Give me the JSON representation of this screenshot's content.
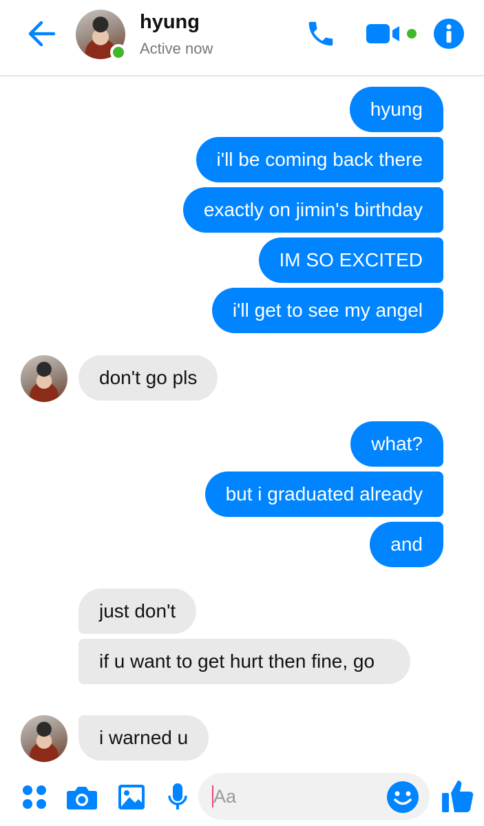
{
  "header": {
    "contact_name": "hyung",
    "status": "Active now",
    "back_icon": "back-arrow-icon",
    "call_icon": "phone-icon",
    "video_icon": "video-camera-icon",
    "info_icon": "info-icon"
  },
  "colors": {
    "accent": "#0084ff",
    "incoming_bubble": "#e9e9e9",
    "online": "#42b72a"
  },
  "messages": [
    {
      "from": "me",
      "text": "hyung"
    },
    {
      "from": "me",
      "text": "i'll be coming back there"
    },
    {
      "from": "me",
      "text": "exactly on jimin's birthday"
    },
    {
      "from": "me",
      "text": "IM SO EXCITED"
    },
    {
      "from": "me",
      "text": "i'll get to see my angel"
    },
    {
      "from": "them",
      "text": "don't go pls"
    },
    {
      "from": "me",
      "text": "what?"
    },
    {
      "from": "me",
      "text": "but i graduated already"
    },
    {
      "from": "me",
      "text": "and"
    },
    {
      "from": "them",
      "text": "just don't"
    },
    {
      "from": "them",
      "text": "if u want to get hurt then fine, go"
    },
    {
      "from": "them",
      "text": "i warned u"
    }
  ],
  "composer": {
    "placeholder": "Aa",
    "icons": [
      "apps-icon",
      "camera-icon",
      "gallery-icon",
      "microphone-icon",
      "emoji-icon",
      "thumbs-up-icon"
    ]
  }
}
